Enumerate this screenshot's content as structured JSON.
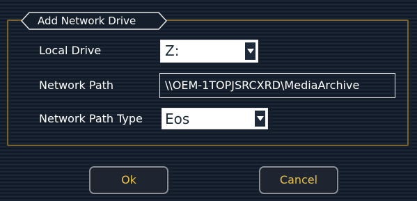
{
  "dialog": {
    "title": "Add Network Drive"
  },
  "fields": {
    "local_drive": {
      "label": "Local Drive",
      "value": "Z:"
    },
    "network_path": {
      "label": "Network Path",
      "value": "\\\\OEM-1TOPJSRCXRD\\MediaArchive"
    },
    "network_path_type": {
      "label": "Network Path Type",
      "value": "Eos"
    }
  },
  "buttons": {
    "ok_label": "Ok",
    "cancel_label": "Cancel"
  },
  "colors": {
    "frame_border": "#7a6230",
    "button_text": "#e8c148",
    "background": "#151f2c"
  },
  "icons": {
    "dropdown": "triangle-down-icon"
  }
}
